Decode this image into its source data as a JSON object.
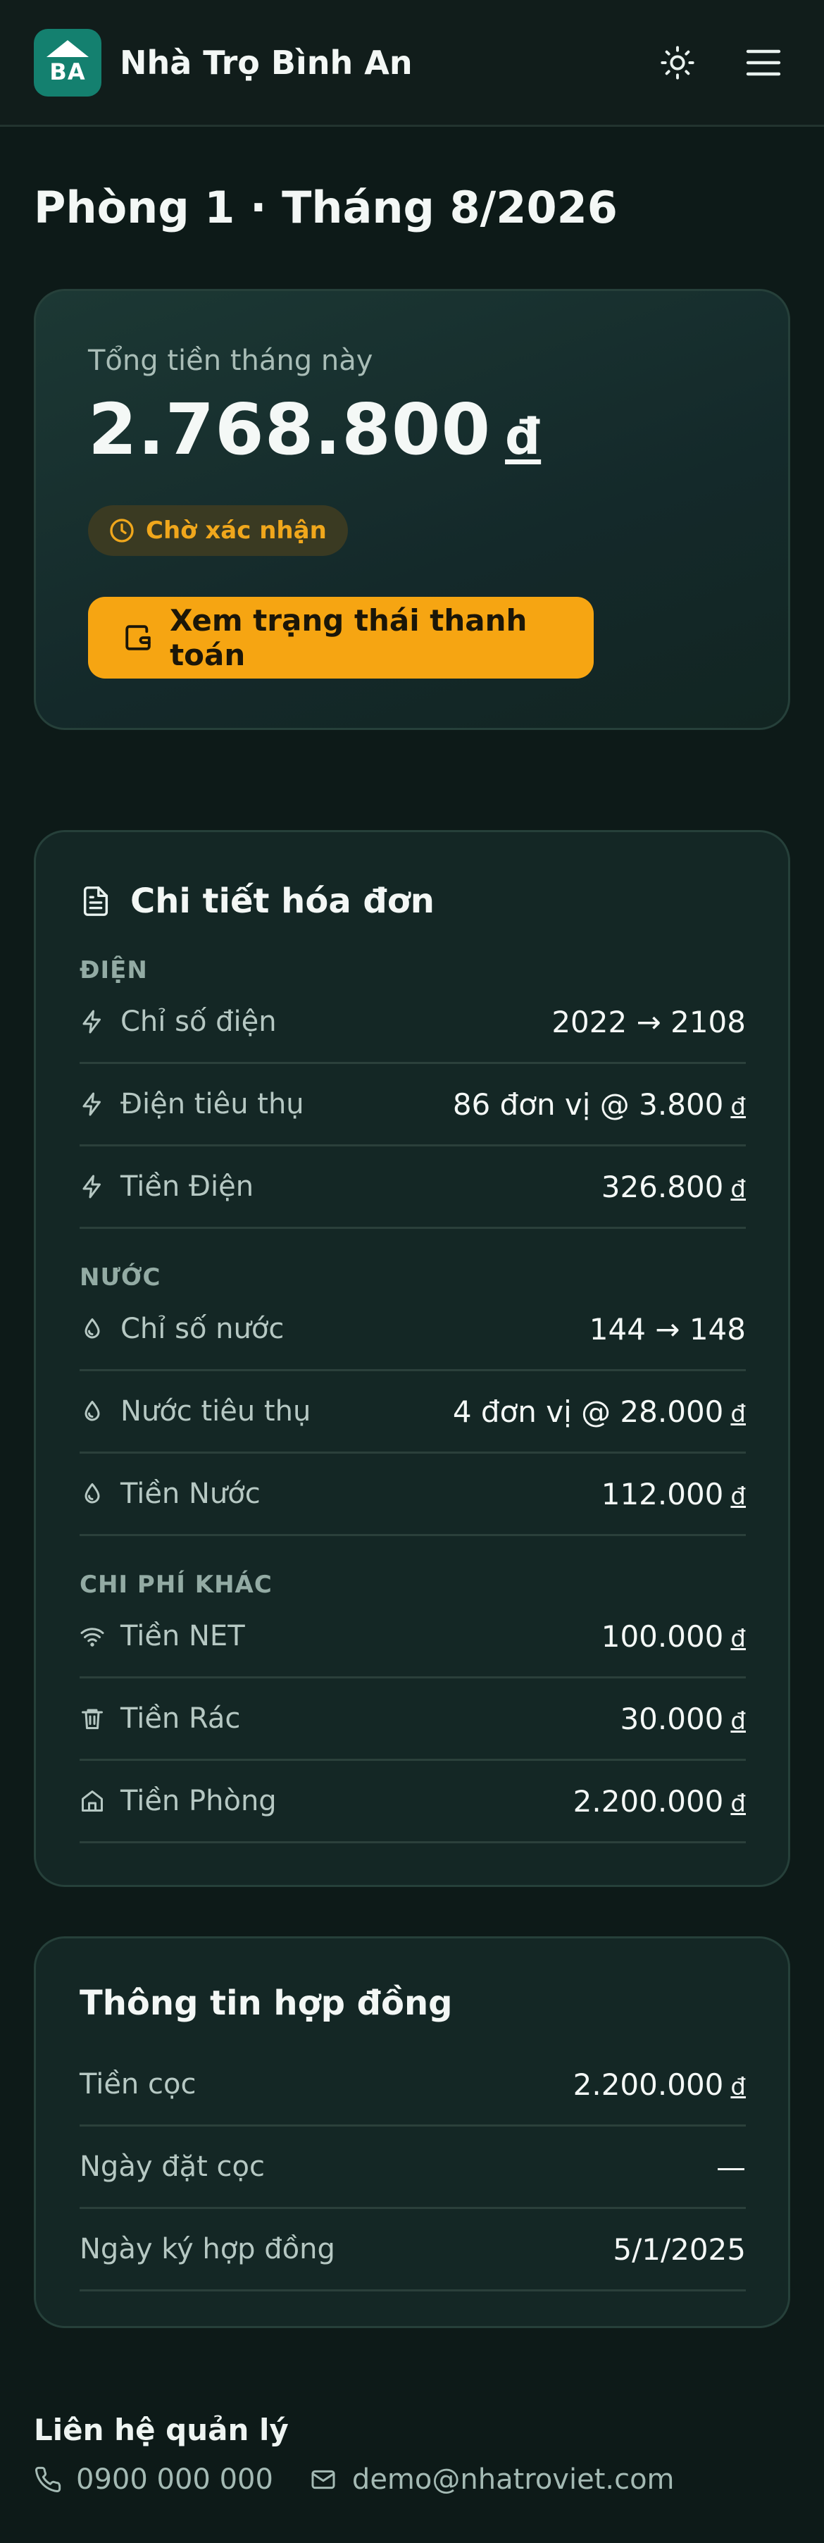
{
  "header": {
    "logo_text": "BA",
    "brand": "Nhà Trọ Bình An"
  },
  "page": {
    "title": "Phòng 1 · Tháng 8/2026"
  },
  "summary": {
    "label": "Tổng tiền tháng này",
    "amount": "2.768.800",
    "currency": "đ",
    "status": "Chờ xác nhận",
    "pay_button": "Xem trạng thái thanh toán"
  },
  "invoice": {
    "title": "Chi tiết hóa đơn",
    "sections": [
      {
        "label": "ĐIỆN",
        "rows": [
          {
            "icon": "lightning-icon",
            "label": "Chỉ số điện",
            "value": "2022 → 2108",
            "currency": ""
          },
          {
            "icon": "lightning-icon",
            "label": "Điện tiêu thụ",
            "value": "86 đơn vị @ 3.800",
            "currency": "đ"
          },
          {
            "icon": "lightning-icon",
            "label": "Tiền Điện",
            "value": "326.800",
            "currency": "đ"
          }
        ]
      },
      {
        "label": "NƯỚC",
        "rows": [
          {
            "icon": "droplet-icon",
            "label": "Chỉ số nước",
            "value": "144 → 148",
            "currency": ""
          },
          {
            "icon": "droplet-icon",
            "label": "Nước tiêu thụ",
            "value": "4 đơn vị @ 28.000",
            "currency": "đ"
          },
          {
            "icon": "droplet-icon",
            "label": "Tiền Nước",
            "value": "112.000",
            "currency": "đ"
          }
        ]
      },
      {
        "label": "CHI PHÍ KHÁC",
        "rows": [
          {
            "icon": "wifi-icon",
            "label": "Tiền NET",
            "value": "100.000",
            "currency": "đ"
          },
          {
            "icon": "trash-icon",
            "label": "Tiền Rác",
            "value": "30.000",
            "currency": "đ"
          },
          {
            "icon": "home-icon",
            "label": "Tiền Phòng",
            "value": "2.200.000",
            "currency": "đ"
          }
        ]
      }
    ]
  },
  "contract": {
    "title": "Thông tin hợp đồng",
    "rows": [
      {
        "label": "Tiền cọc",
        "value": "2.200.000",
        "currency": "đ"
      },
      {
        "label": "Ngày đặt cọc",
        "value": "—",
        "currency": ""
      },
      {
        "label": "Ngày ký hợp đồng",
        "value": "5/1/2025",
        "currency": ""
      }
    ]
  },
  "footer": {
    "title": "Liên hệ quản lý",
    "phone": "0900 000 000",
    "email": "demo@nhatroviet.com"
  },
  "colors": {
    "background": "#0d1a18",
    "accent": "#f6a512",
    "brand": "#14806f",
    "status": "#f0a71c"
  }
}
